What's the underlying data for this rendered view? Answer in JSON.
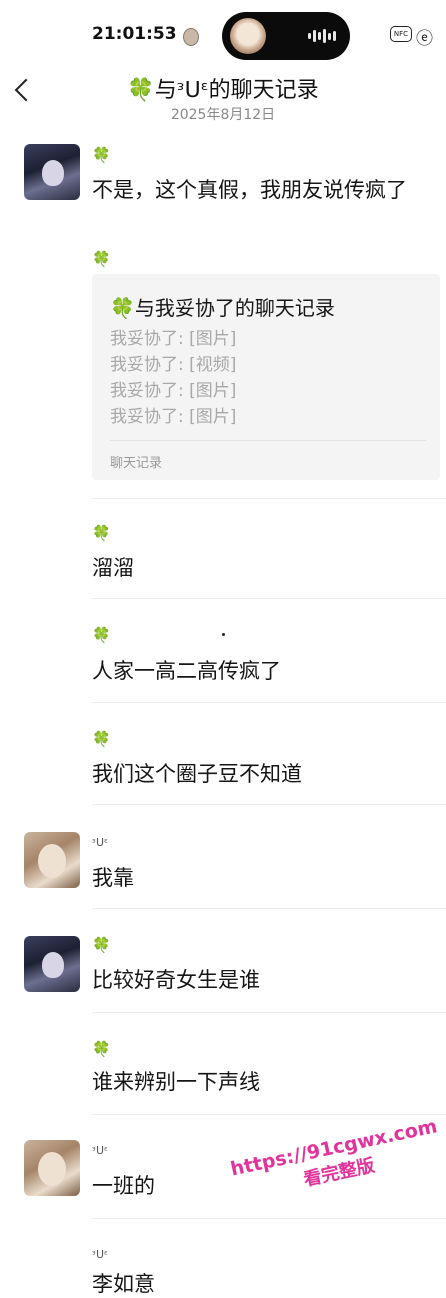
{
  "status_bar": {
    "time": "21:01:53",
    "nfc_label": "NFC",
    "misc_glyph": "ⓔ"
  },
  "header": {
    "title": "🍀与ᵌᑌᵋ的聊天记录",
    "date": "2025年8月12日"
  },
  "messages": [
    {
      "sender": "🍀",
      "text": "不是，这个真假，我朋友说传疯了"
    },
    {
      "sender": "🍀",
      "text": ""
    },
    {
      "sender": "🍀",
      "text": "溜溜"
    },
    {
      "sender": "🍀",
      "text": "人家一高二高传疯了"
    },
    {
      "sender": "🍀",
      "text": "我们这个圈子豆不知道"
    },
    {
      "sender": "ᵌᑌᵋ",
      "text": "我靠"
    },
    {
      "sender": "🍀",
      "text": "比较好奇女生是谁"
    },
    {
      "sender": "🍀",
      "text": "谁来辨别一下声线"
    },
    {
      "sender": "ᵌᑌᵋ",
      "text": "一班的"
    },
    {
      "sender": "ᵌᑌᵋ",
      "text": "李如意"
    }
  ],
  "quoted_card": {
    "title": "🍀与我妥协了的聊天记录",
    "lines": [
      "我妥协了: [图片]",
      "我妥协了: [视频]",
      "我妥协了: [图片]",
      "我妥协了: [图片]"
    ],
    "footer": "聊天记录"
  },
  "watermark": {
    "url": "https://91cgwx.com",
    "text": "看完整版"
  }
}
